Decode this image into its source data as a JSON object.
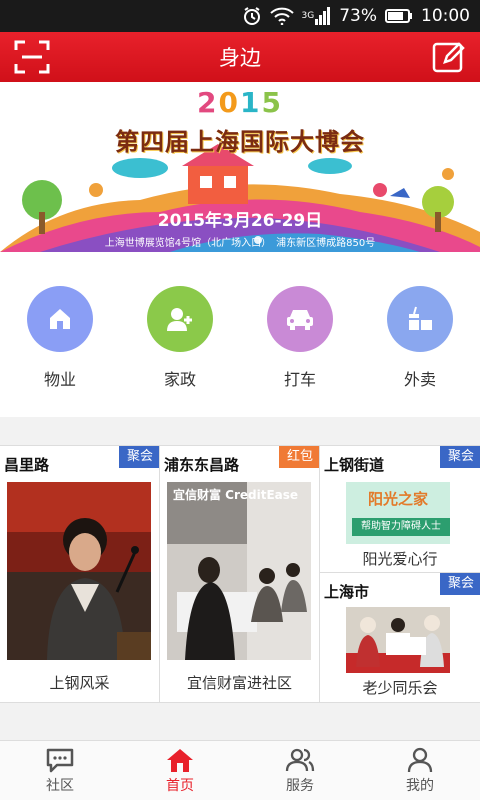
{
  "status_bar": {
    "network": "3G",
    "battery": "73%",
    "time": "10:00"
  },
  "header": {
    "title": "身边"
  },
  "banner": {
    "year_digits": [
      "2",
      "0",
      "1",
      "5"
    ],
    "title": "第四届上海国际大博会",
    "date": "2015年3月26-29日",
    "venue": "上海世博展览馆4号馆（北广场入口）　浦东新区博成路850号"
  },
  "services": [
    {
      "label": "物业",
      "icon": "home-icon",
      "color": "#8a9ef5"
    },
    {
      "label": "家政",
      "icon": "add-user-icon",
      "color": "#8bc94a"
    },
    {
      "label": "打车",
      "icon": "taxi-icon",
      "color": "#c98ad6"
    },
    {
      "label": "外卖",
      "icon": "takeout-icon",
      "color": "#8aa7ef"
    }
  ],
  "cards": [
    {
      "location": "昌里路",
      "tag": "聚会",
      "caption": "上钢风采"
    },
    {
      "location": "浦东东昌路",
      "tag": "红包",
      "caption": "宜信财富进社区",
      "photo_text": "宜信财富 CreditEase"
    },
    {
      "location": "上钢街道",
      "tag": "聚会",
      "caption": "阳光爱心行",
      "photo_title": "阳光之家",
      "photo_sub": "帮助智力障碍人士"
    },
    {
      "location": "上海市",
      "tag": "聚会",
      "caption": "老少同乐会"
    }
  ],
  "bottom_nav": [
    {
      "label": "社区",
      "icon": "chat-icon"
    },
    {
      "label": "首页",
      "icon": "home-icon",
      "active": true
    },
    {
      "label": "服务",
      "icon": "people-icon"
    },
    {
      "label": "我的",
      "icon": "person-icon"
    }
  ],
  "colors": {
    "brand_red": "#e8212b",
    "tag_blue": "#3a67c6",
    "tag_orange": "#f07a35"
  }
}
